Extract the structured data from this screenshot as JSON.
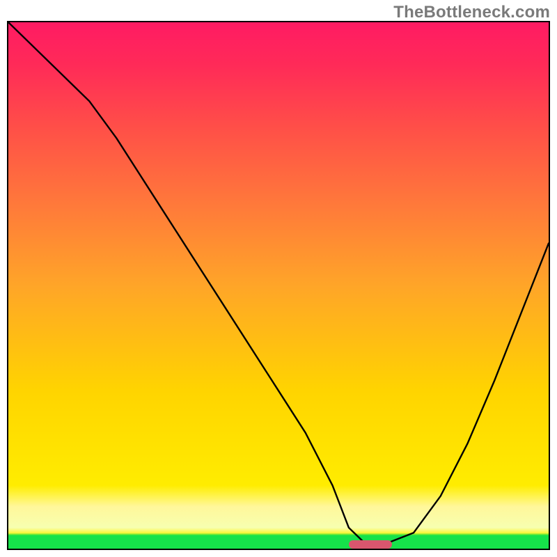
{
  "watermark": "TheBottleneck.com",
  "chart_data": {
    "type": "line",
    "title": "",
    "xlabel": "",
    "ylabel": "",
    "xlim": [
      0,
      100
    ],
    "ylim": [
      0,
      100
    ],
    "grid": false,
    "legend": false,
    "series": [
      {
        "name": "bottleneck-curve",
        "x": [
          0,
          15,
          20,
          25,
          30,
          35,
          40,
          45,
          50,
          55,
          60,
          63,
          66,
          70,
          75,
          80,
          85,
          90,
          95,
          100
        ],
        "values": [
          100,
          85,
          78,
          70,
          62,
          54,
          46,
          38,
          30,
          22,
          12,
          4,
          1,
          1,
          3,
          10,
          20,
          32,
          45,
          58
        ]
      }
    ],
    "optimum_marker": {
      "x_start": 63,
      "x_end": 71,
      "y": 0.8
    },
    "background": {
      "type": "vertical-gradient",
      "stops": [
        {
          "pos": 0,
          "color": "#16e24a"
        },
        {
          "pos": 3,
          "color": "#f7ffb0"
        },
        {
          "pos": 8,
          "color": "#fff200"
        },
        {
          "pos": 30,
          "color": "#ffd400"
        },
        {
          "pos": 50,
          "color": "#ffa528"
        },
        {
          "pos": 65,
          "color": "#ff7a3a"
        },
        {
          "pos": 80,
          "color": "#ff4f48"
        },
        {
          "pos": 92,
          "color": "#ff2a58"
        },
        {
          "pos": 100,
          "color": "#ff1b63"
        }
      ]
    }
  }
}
